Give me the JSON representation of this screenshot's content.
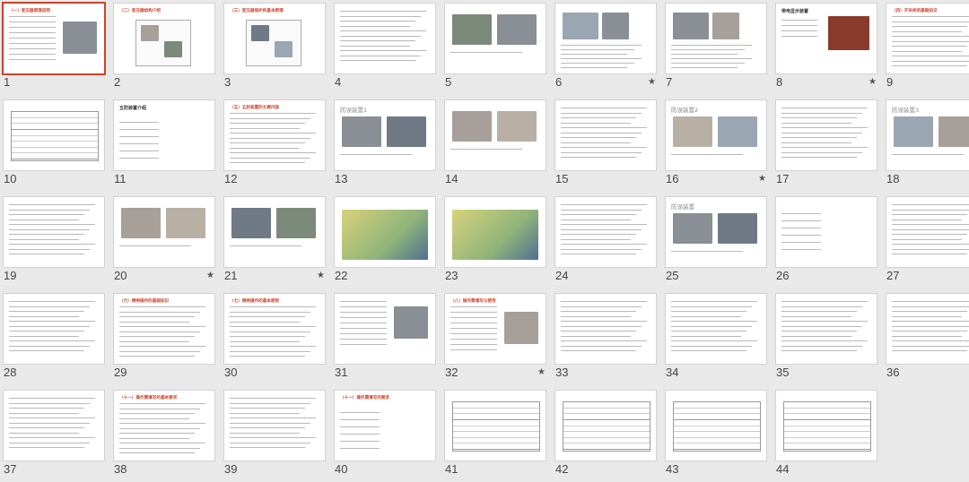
{
  "app": {
    "view": "slide-sorter",
    "selected_slide": 1
  },
  "accent_color": "#c8432d",
  "slides": [
    {
      "n": "1",
      "title": "（一）变压器原理说明",
      "star": false,
      "kind": "text-photo"
    },
    {
      "n": "2",
      "title": "（二）变压器结构介绍",
      "star": false,
      "kind": "diagram"
    },
    {
      "n": "3",
      "title": "（三）变压器保护的基本原理",
      "star": false,
      "kind": "schematic"
    },
    {
      "n": "4",
      "title": "",
      "star": false,
      "kind": "text"
    },
    {
      "n": "5",
      "title": "",
      "star": false,
      "kind": "photos"
    },
    {
      "n": "6",
      "title": "",
      "star": true,
      "kind": "photos-text"
    },
    {
      "n": "7",
      "title": "",
      "star": false,
      "kind": "photos-text"
    },
    {
      "n": "8",
      "title": "带电显示装置",
      "star": true,
      "kind": "photo-right"
    },
    {
      "n": "9",
      "title": "（四）开关柜的基础知识",
      "star": false,
      "kind": "text"
    },
    {
      "n": "10",
      "title": "",
      "star": false,
      "kind": "table"
    },
    {
      "n": "11",
      "title": "五防装置介绍",
      "star": false,
      "kind": "list"
    },
    {
      "n": "12",
      "title": "（五）五防装置的主要内容",
      "star": false,
      "kind": "text"
    },
    {
      "n": "13",
      "title": "防误装置1",
      "star": false,
      "kind": "photos"
    },
    {
      "n": "14",
      "title": "",
      "star": false,
      "kind": "photos"
    },
    {
      "n": "15",
      "title": "",
      "star": false,
      "kind": "text"
    },
    {
      "n": "16",
      "title": "防误装置2",
      "star": true,
      "kind": "photos"
    },
    {
      "n": "17",
      "title": "",
      "star": false,
      "kind": "text"
    },
    {
      "n": "18",
      "title": "防误装置3",
      "star": false,
      "kind": "photos"
    },
    {
      "n": "19",
      "title": "",
      "star": false,
      "kind": "text"
    },
    {
      "n": "20",
      "title": "",
      "star": true,
      "kind": "photos"
    },
    {
      "n": "21",
      "title": "",
      "star": true,
      "kind": "photos"
    },
    {
      "n": "22",
      "title": "",
      "star": false,
      "kind": "3d"
    },
    {
      "n": "23",
      "title": "",
      "star": false,
      "kind": "3d"
    },
    {
      "n": "24",
      "title": "",
      "star": false,
      "kind": "text"
    },
    {
      "n": "25",
      "title": "防误装置",
      "star": false,
      "kind": "photos"
    },
    {
      "n": "26",
      "title": "",
      "star": false,
      "kind": "list"
    },
    {
      "n": "27",
      "title": "",
      "star": false,
      "kind": "text"
    },
    {
      "n": "28",
      "title": "",
      "star": false,
      "kind": "text"
    },
    {
      "n": "29",
      "title": "（六）倒闸操作的基础知识",
      "star": false,
      "kind": "text"
    },
    {
      "n": "30",
      "title": "（七）倒闸操作的基本原则",
      "star": false,
      "kind": "text"
    },
    {
      "n": "31",
      "title": "",
      "star": false,
      "kind": "text-photo"
    },
    {
      "n": "32",
      "title": "（八）操作票填写与使用",
      "star": true,
      "kind": "text-photo"
    },
    {
      "n": "33",
      "title": "",
      "star": false,
      "kind": "text"
    },
    {
      "n": "34",
      "title": "",
      "star": false,
      "kind": "text"
    },
    {
      "n": "35",
      "title": "",
      "star": false,
      "kind": "text"
    },
    {
      "n": "36",
      "title": "",
      "star": false,
      "kind": "text"
    },
    {
      "n": "37",
      "title": "",
      "star": false,
      "kind": "text"
    },
    {
      "n": "38",
      "title": "（十一）操作票填写的基本要求",
      "star": false,
      "kind": "text"
    },
    {
      "n": "39",
      "title": "",
      "star": false,
      "kind": "text"
    },
    {
      "n": "40",
      "title": "（十一）操作票填写的要求",
      "star": false,
      "kind": "list"
    },
    {
      "n": "41",
      "title": "",
      "star": false,
      "kind": "table"
    },
    {
      "n": "42",
      "title": "",
      "star": false,
      "kind": "table"
    },
    {
      "n": "43",
      "title": "",
      "star": false,
      "kind": "table"
    },
    {
      "n": "44",
      "title": "",
      "star": false,
      "kind": "table"
    }
  ]
}
